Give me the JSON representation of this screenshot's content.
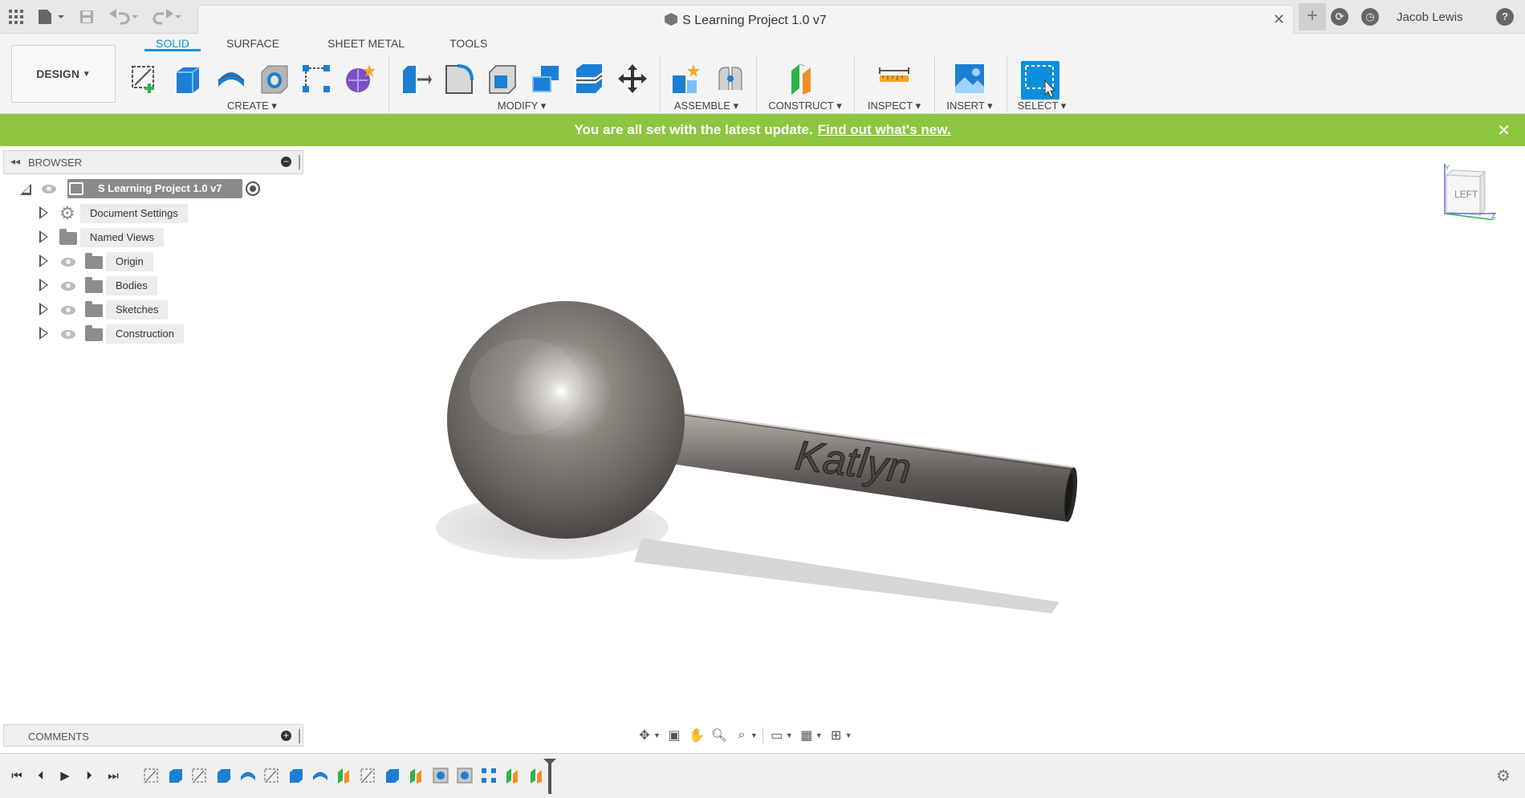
{
  "titlebar": {
    "doc_title": "S Learning Project 1.0 v7",
    "user_name": "Jacob Lewis",
    "icons": [
      "apps-grid-icon",
      "file-icon",
      "save-icon",
      "undo-icon",
      "redo-icon",
      "new-tab-icon",
      "job-status-icon",
      "notifications-icon",
      "help-icon"
    ]
  },
  "toolbar": {
    "workspace": "DESIGN",
    "tabs": [
      "SOLID",
      "SURFACE",
      "SHEET METAL",
      "TOOLS"
    ],
    "active_tab": "SOLID",
    "groups": {
      "create": "CREATE",
      "modify": "MODIFY",
      "assemble": "ASSEMBLE",
      "construct": "CONSTRUCT",
      "inspect": "INSPECT",
      "insert": "INSERT",
      "select": "SELECT"
    },
    "colors": {
      "accent": "#0696d7",
      "solid_blue": "#1c7fd3",
      "purple": "#7b4fc8"
    }
  },
  "banner": {
    "message": "You are all set with the latest update.",
    "link": "Find out what's new.",
    "color": "#8cc63f"
  },
  "browser": {
    "title": "BROWSER",
    "root": "S Learning Project 1.0 v7",
    "items": [
      {
        "label": "Document Settings",
        "icon": "gear-icon",
        "eye": false
      },
      {
        "label": "Named Views",
        "icon": "folder-icon",
        "eye": false
      },
      {
        "label": "Origin",
        "icon": "folder-icon",
        "eye": true
      },
      {
        "label": "Bodies",
        "icon": "folder-icon",
        "eye": true
      },
      {
        "label": "Sketches",
        "icon": "folder-icon",
        "eye": true
      },
      {
        "label": "Construction",
        "icon": "folder-icon",
        "eye": true
      }
    ]
  },
  "viewport": {
    "engraved_text": "Katlyn",
    "viewcube_face": "LEFT",
    "axis_y": "Y",
    "axis_z": "Z"
  },
  "comments": {
    "title": "COMMENTS"
  },
  "timeline": {
    "feature_count": 17
  }
}
